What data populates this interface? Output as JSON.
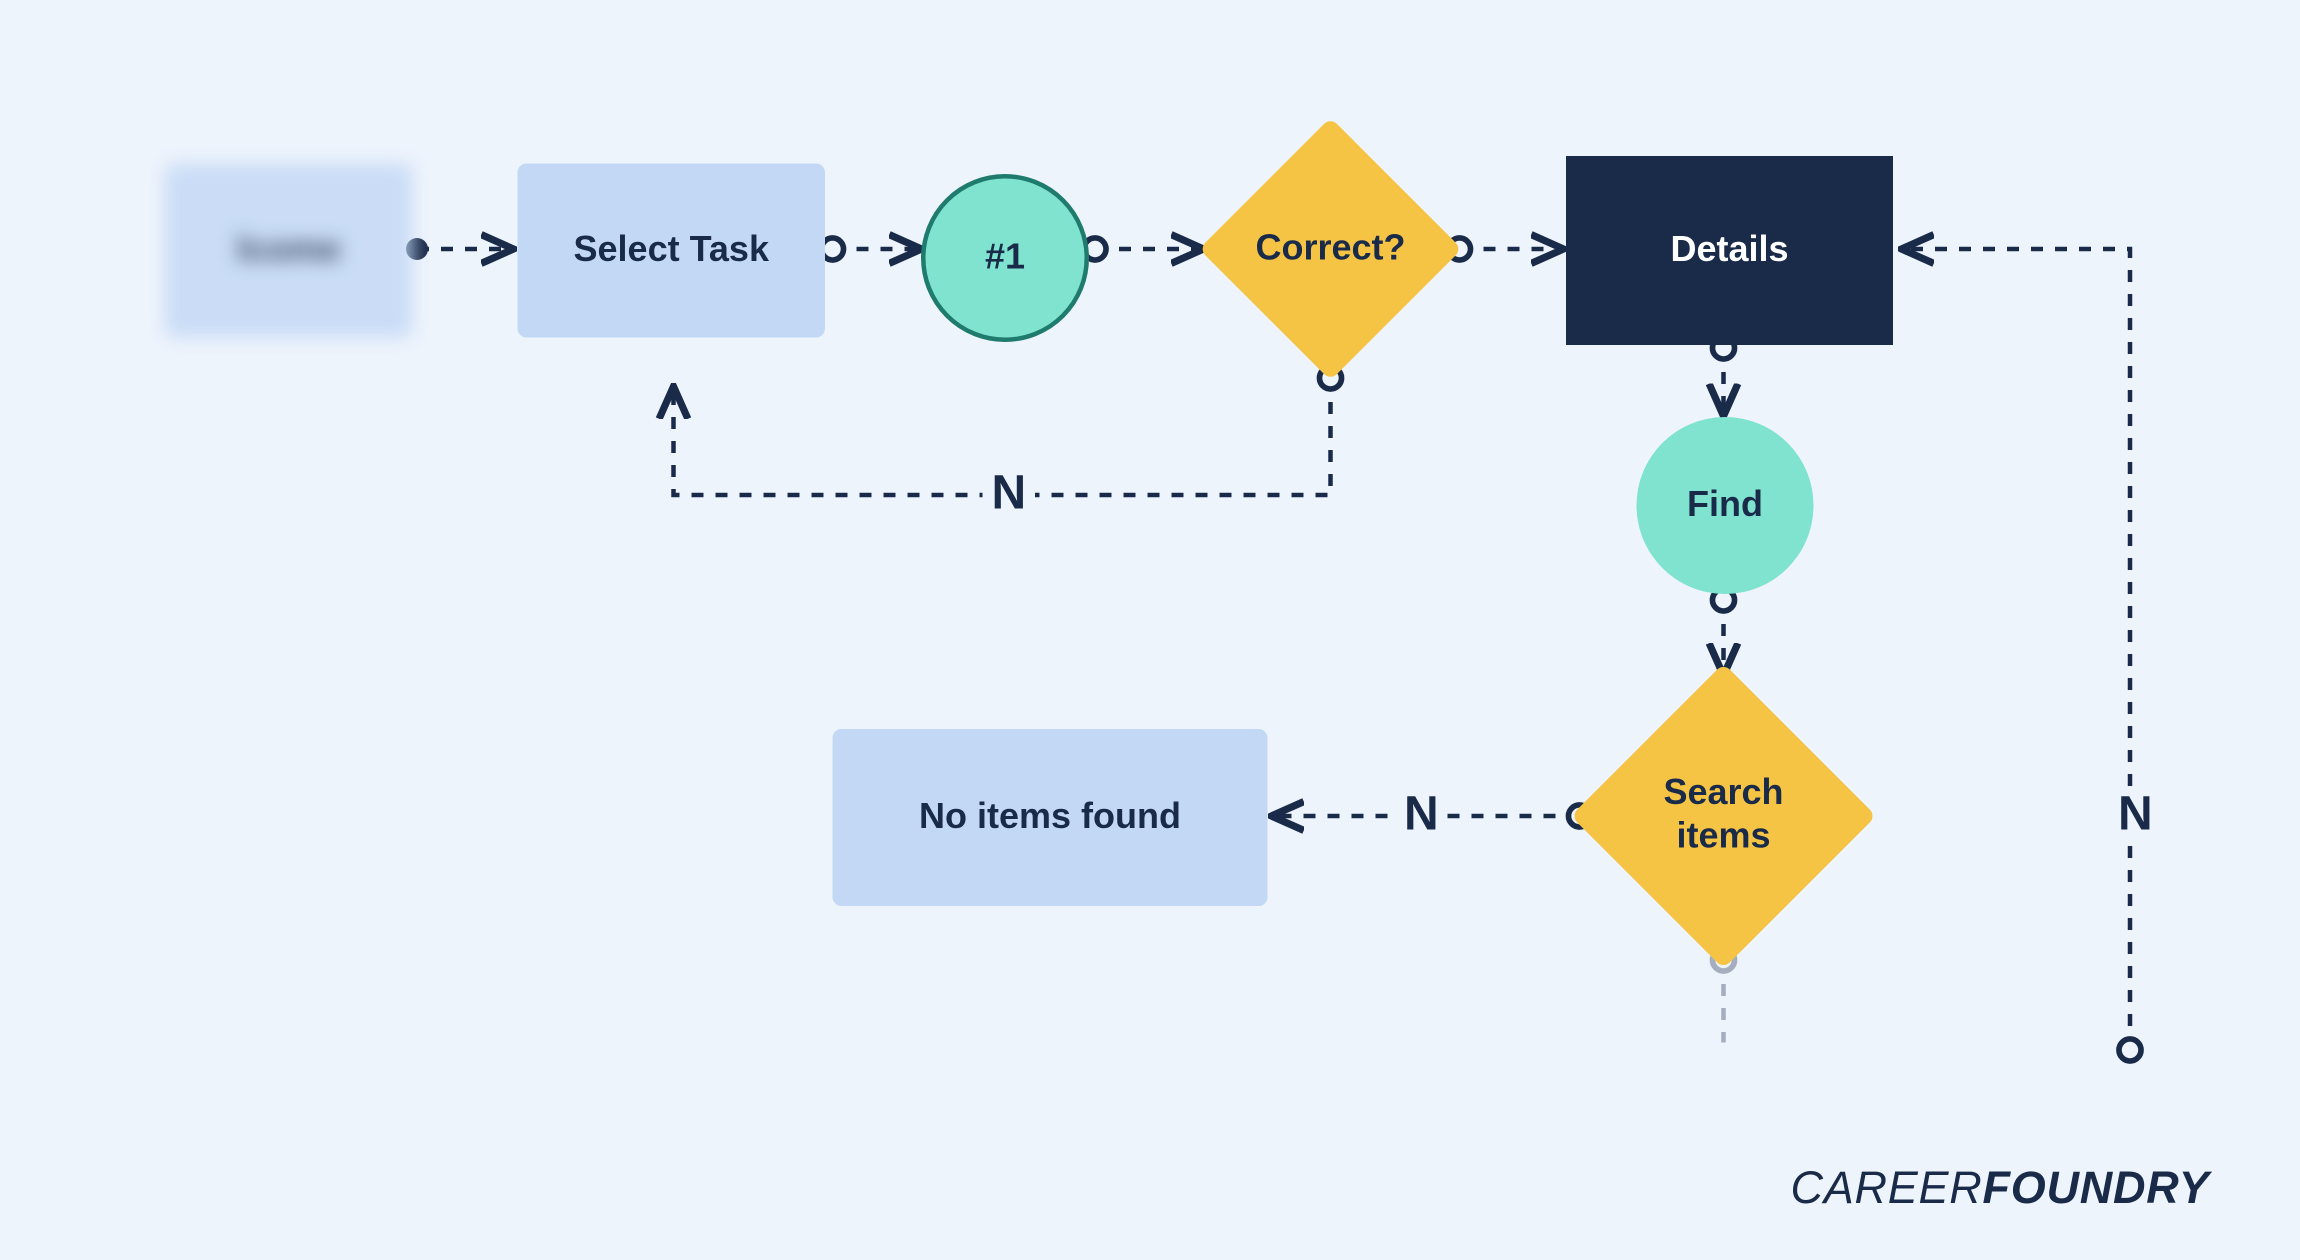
{
  "nodes": {
    "welcome": "lcome",
    "select_task": "Select Task",
    "step1": "#1",
    "correct": "Correct?",
    "details": "Details",
    "find": "Find",
    "search_items": "Search\nitems",
    "no_items_found": "No items found"
  },
  "edge_labels": {
    "correct_no": "N",
    "search_no": "N",
    "right_no": "N"
  },
  "brand": {
    "thin": "CAREER",
    "thick": "FOUNDRY"
  },
  "colors": {
    "bg": "#eef4fc",
    "light_box": "#c3d8f5",
    "dark_box": "#1a2b4a",
    "teal": "#7fe3cf",
    "teal_border": "#1f7b6d",
    "yellow": "#f6c445",
    "ink": "#1a2b4a"
  }
}
